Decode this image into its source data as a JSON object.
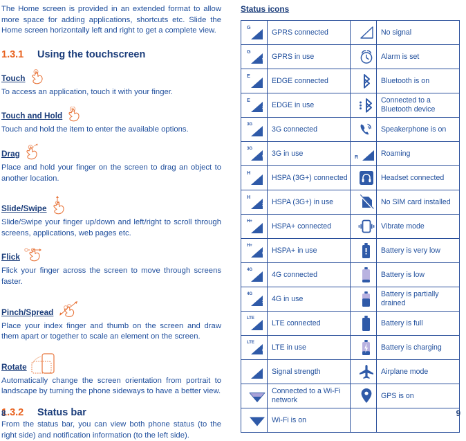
{
  "left_page": {
    "intro": "The Home screen is provided in an extended format to allow more space for adding applications, shortcuts etc. Slide the Home screen horizontally left and right to get a complete view.",
    "section_touchscreen": {
      "number": "1.3.1",
      "title": "Using the touchscreen"
    },
    "gestures": [
      {
        "label": "Touch",
        "icon": "hand-touch-icon",
        "text": "To access an application, touch it with your finger."
      },
      {
        "label": "Touch and Hold",
        "icon": "hand-touch-hold-icon",
        "text": "Touch and hold the item to enter the available options."
      },
      {
        "label": "Drag",
        "icon": "hand-drag-icon",
        "text": "Place and hold your finger on the screen to drag an object to another location."
      },
      {
        "label": "Slide/Swipe",
        "icon": "hand-slide-swipe-icon",
        "text": "Slide/Swipe your finger up/down and left/right to scroll through screens, applications, web pages etc."
      },
      {
        "label": "Flick",
        "icon": "hand-flick-icon",
        "text": "Flick your finger across the screen to move through screens faster."
      },
      {
        "label": "Pinch/Spread",
        "icon": "hand-pinch-spread-icon",
        "text": "Place your index finger and thumb on the screen and draw them apart or together to scale an element on the screen."
      },
      {
        "label": "Rotate",
        "icon": "phone-rotate-icon",
        "text": "Automatically change the screen orientation from portrait to landscape by turning the phone sideways to have a better view."
      }
    ],
    "section_statusbar": {
      "number": "1.3.2",
      "title": "Status bar"
    },
    "statusbar_text": "From the status bar, you can view both phone status (to the right side) and notification information (to the left side).",
    "page_number": "8"
  },
  "right_page": {
    "title": "Status icons",
    "page_number": "9",
    "rows": [
      {
        "left_icon": "gprs-connected-icon",
        "left_label": "GPRS connected",
        "right_icon": "no-signal-icon",
        "right_label": "No signal"
      },
      {
        "left_icon": "gprs-in-use-icon",
        "left_label": "GPRS in use",
        "right_icon": "alarm-icon",
        "right_label": "Alarm is set"
      },
      {
        "left_icon": "edge-connected-icon",
        "left_label": "EDGE connected",
        "right_icon": "bluetooth-icon",
        "right_label": "Bluetooth is on"
      },
      {
        "left_icon": "edge-in-use-icon",
        "left_label": "EDGE in use",
        "right_icon": "bluetooth-connected-icon",
        "right_label": "Connected to a Bluetooth device"
      },
      {
        "left_icon": "3g-connected-icon",
        "left_label": "3G connected",
        "right_icon": "speakerphone-icon",
        "right_label": "Speakerphone is on"
      },
      {
        "left_icon": "3g-in-use-icon",
        "left_label": "3G in use",
        "right_icon": "roaming-icon",
        "right_label": "Roaming"
      },
      {
        "left_icon": "hspa-connected-icon",
        "left_label": "HSPA (3G+) connected",
        "right_icon": "headset-icon",
        "right_label": "Headset connected"
      },
      {
        "left_icon": "hspa-in-use-icon",
        "left_label": "HSPA (3G+) in use",
        "right_icon": "no-sim-card-icon",
        "right_label": "No SIM card installed"
      },
      {
        "left_icon": "hspaplus-connected-icon",
        "left_label": "HSPA+ connected",
        "right_icon": "vibrate-icon",
        "right_label": "Vibrate mode"
      },
      {
        "left_icon": "hspaplus-in-use-icon",
        "left_label": "HSPA+ in use",
        "right_icon": "battery-very-low-icon",
        "right_label": "Battery is very low"
      },
      {
        "left_icon": "4g-connected-icon",
        "left_label": "4G connected",
        "right_icon": "battery-low-icon",
        "right_label": "Battery is low"
      },
      {
        "left_icon": "4g-in-use-icon",
        "left_label": "4G in use",
        "right_icon": "battery-partial-icon",
        "right_label": "Battery is partially drained"
      },
      {
        "left_icon": "lte-connected-icon",
        "left_label": "LTE connected",
        "right_icon": "battery-full-icon",
        "right_label": "Battery is full"
      },
      {
        "left_icon": "lte-in-use-icon",
        "left_label": "LTE in use",
        "right_icon": "battery-charging-icon",
        "right_label": "Battery is charging"
      },
      {
        "left_icon": "signal-strength-icon",
        "left_label": "Signal strength",
        "right_icon": "airplane-mode-icon",
        "right_label": "Airplane mode"
      },
      {
        "left_icon": "wifi-connected-icon",
        "left_label": "Connected to a Wi-Fi network",
        "right_icon": "gps-icon",
        "right_label": "GPS is on"
      },
      {
        "left_icon": "wifi-on-icon",
        "left_label": "Wi-Fi is on",
        "right_icon": "",
        "right_label": ""
      }
    ],
    "signal_labels": [
      "G",
      "G",
      "E",
      "E",
      "3G",
      "3G",
      "H",
      "H",
      "H+",
      "H+",
      "4G",
      "4G",
      "LTE",
      "LTE",
      ""
    ]
  },
  "colors": {
    "text_blue": "#1f4e9c",
    "head_blue": "#1a3c7a",
    "accent_orange": "#e8621f",
    "icon_blue": "#2f5aa8",
    "table_border": "#2a4f9b"
  }
}
